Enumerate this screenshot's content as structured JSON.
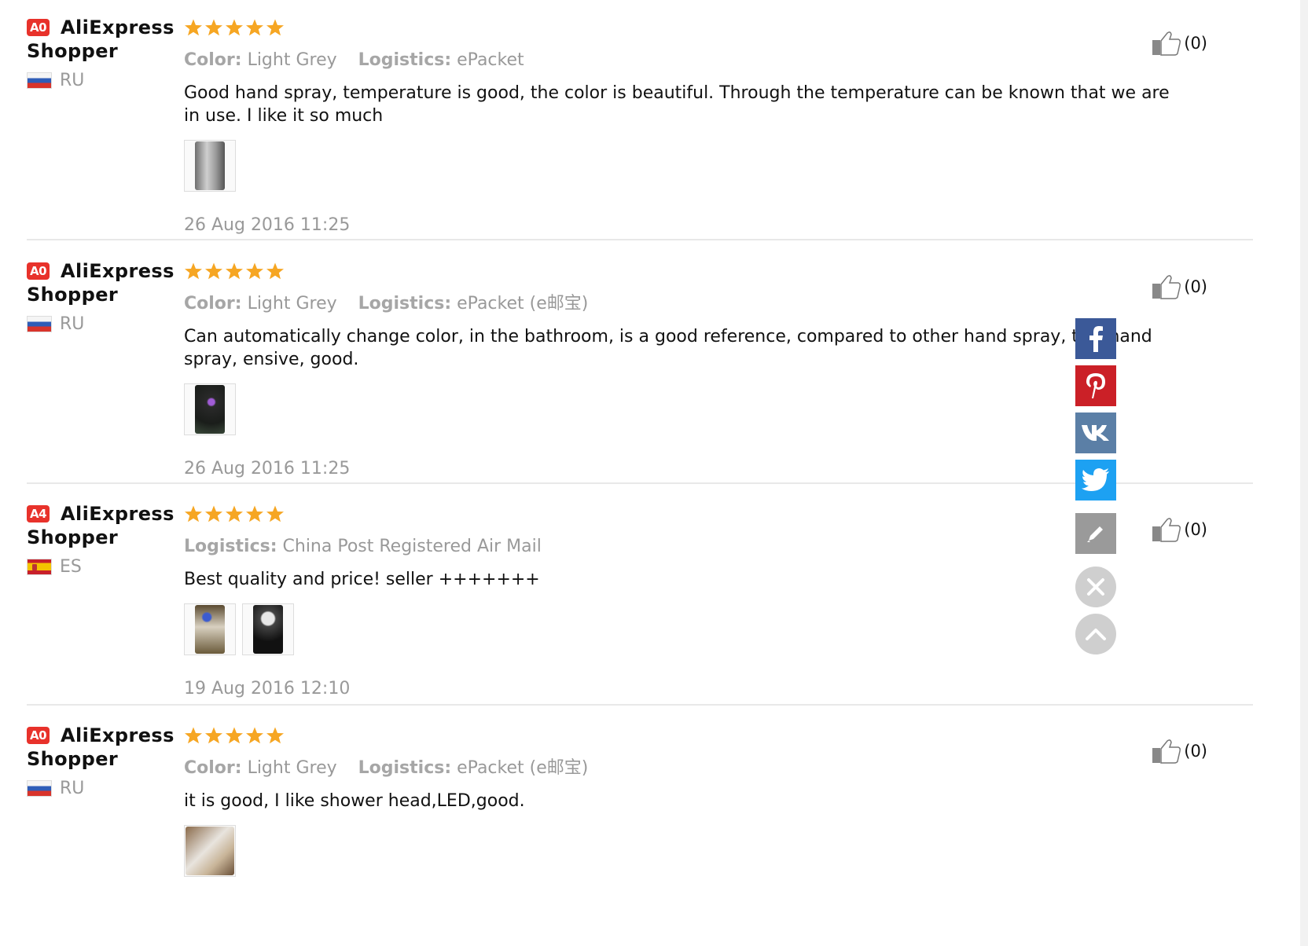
{
  "reviews": [
    {
      "level": "A0",
      "user_first": "AliExpress",
      "user_second": "Shopper",
      "country": "RU",
      "rating": 5,
      "color_label": "Color:",
      "color_value": "Light Grey",
      "logistics_label": "Logistics:",
      "logistics_value": "ePacket",
      "text": "Good hand spray, temperature is good, the color is beautiful. Through the temperature can be known that we are in use. I like it so much",
      "photos": 1,
      "date": "26 Aug 2016 11:25",
      "helpful": "(0)"
    },
    {
      "level": "A0",
      "user_first": "AliExpress",
      "user_second": "Shopper",
      "country": "RU",
      "rating": 5,
      "color_label": "Color:",
      "color_value": "Light Grey",
      "logistics_label": "Logistics:",
      "logistics_value": "ePacket (e邮宝)",
      "text": "Can automatically change color, in the bathroom, is a good reference, compared to other hand spray, this hand spray, ensive, good.",
      "photos": 1,
      "date": "26 Aug 2016 11:25",
      "helpful": "(0)"
    },
    {
      "level": "A4",
      "user_first": "AliExpress",
      "user_second": "Shopper",
      "country": "ES",
      "rating": 5,
      "logistics_label": "Logistics:",
      "logistics_value": "China Post Registered Air Mail",
      "text": "Best quality and price! seller +++++++",
      "photos": 2,
      "date": "19 Aug 2016 12:10",
      "helpful": "(0)"
    },
    {
      "level": "A0",
      "user_first": "AliExpress",
      "user_second": "Shopper",
      "country": "RU",
      "rating": 5,
      "color_label": "Color:",
      "color_value": "Light Grey",
      "logistics_label": "Logistics:",
      "logistics_value": "ePacket (e邮宝)",
      "text": "it is good, I like shower head,LED,good.",
      "photos": 1,
      "helpful": "(0)"
    }
  ],
  "colors": {
    "level_badge": "#e8322b",
    "star": "#f6a623",
    "facebook": "#3b5998",
    "pinterest": "#cb2027",
    "vk": "#5b7fa6",
    "twitter": "#1da1f2"
  },
  "share_icons": [
    "facebook-icon",
    "pinterest-icon",
    "vk-icon",
    "twitter-icon",
    "edit-icon",
    "close-icon",
    "scroll-top-icon"
  ]
}
